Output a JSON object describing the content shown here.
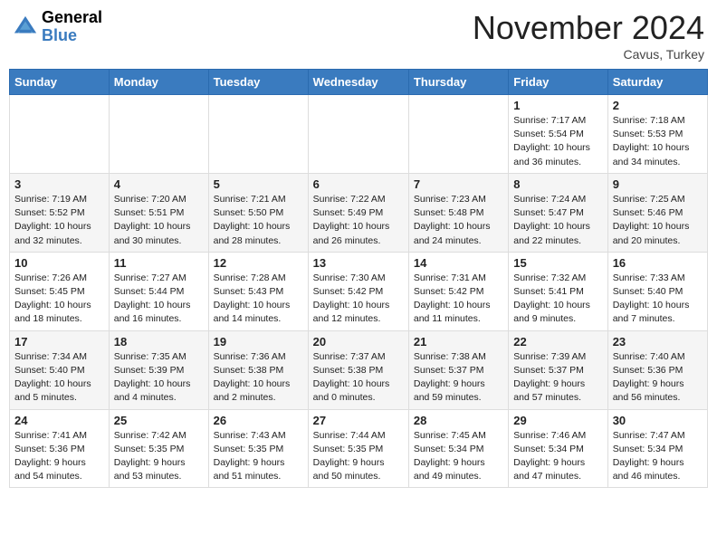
{
  "header": {
    "logo_line1": "General",
    "logo_line2": "Blue",
    "month_title": "November 2024",
    "location": "Cavus, Turkey"
  },
  "days_of_week": [
    "Sunday",
    "Monday",
    "Tuesday",
    "Wednesday",
    "Thursday",
    "Friday",
    "Saturday"
  ],
  "weeks": [
    {
      "days": [
        {
          "num": "",
          "info": ""
        },
        {
          "num": "",
          "info": ""
        },
        {
          "num": "",
          "info": ""
        },
        {
          "num": "",
          "info": ""
        },
        {
          "num": "",
          "info": ""
        },
        {
          "num": "1",
          "info": "Sunrise: 7:17 AM\nSunset: 5:54 PM\nDaylight: 10 hours\nand 36 minutes."
        },
        {
          "num": "2",
          "info": "Sunrise: 7:18 AM\nSunset: 5:53 PM\nDaylight: 10 hours\nand 34 minutes."
        }
      ]
    },
    {
      "days": [
        {
          "num": "3",
          "info": "Sunrise: 7:19 AM\nSunset: 5:52 PM\nDaylight: 10 hours\nand 32 minutes."
        },
        {
          "num": "4",
          "info": "Sunrise: 7:20 AM\nSunset: 5:51 PM\nDaylight: 10 hours\nand 30 minutes."
        },
        {
          "num": "5",
          "info": "Sunrise: 7:21 AM\nSunset: 5:50 PM\nDaylight: 10 hours\nand 28 minutes."
        },
        {
          "num": "6",
          "info": "Sunrise: 7:22 AM\nSunset: 5:49 PM\nDaylight: 10 hours\nand 26 minutes."
        },
        {
          "num": "7",
          "info": "Sunrise: 7:23 AM\nSunset: 5:48 PM\nDaylight: 10 hours\nand 24 minutes."
        },
        {
          "num": "8",
          "info": "Sunrise: 7:24 AM\nSunset: 5:47 PM\nDaylight: 10 hours\nand 22 minutes."
        },
        {
          "num": "9",
          "info": "Sunrise: 7:25 AM\nSunset: 5:46 PM\nDaylight: 10 hours\nand 20 minutes."
        }
      ]
    },
    {
      "days": [
        {
          "num": "10",
          "info": "Sunrise: 7:26 AM\nSunset: 5:45 PM\nDaylight: 10 hours\nand 18 minutes."
        },
        {
          "num": "11",
          "info": "Sunrise: 7:27 AM\nSunset: 5:44 PM\nDaylight: 10 hours\nand 16 minutes."
        },
        {
          "num": "12",
          "info": "Sunrise: 7:28 AM\nSunset: 5:43 PM\nDaylight: 10 hours\nand 14 minutes."
        },
        {
          "num": "13",
          "info": "Sunrise: 7:30 AM\nSunset: 5:42 PM\nDaylight: 10 hours\nand 12 minutes."
        },
        {
          "num": "14",
          "info": "Sunrise: 7:31 AM\nSunset: 5:42 PM\nDaylight: 10 hours\nand 11 minutes."
        },
        {
          "num": "15",
          "info": "Sunrise: 7:32 AM\nSunset: 5:41 PM\nDaylight: 10 hours\nand 9 minutes."
        },
        {
          "num": "16",
          "info": "Sunrise: 7:33 AM\nSunset: 5:40 PM\nDaylight: 10 hours\nand 7 minutes."
        }
      ]
    },
    {
      "days": [
        {
          "num": "17",
          "info": "Sunrise: 7:34 AM\nSunset: 5:40 PM\nDaylight: 10 hours\nand 5 minutes."
        },
        {
          "num": "18",
          "info": "Sunrise: 7:35 AM\nSunset: 5:39 PM\nDaylight: 10 hours\nand 4 minutes."
        },
        {
          "num": "19",
          "info": "Sunrise: 7:36 AM\nSunset: 5:38 PM\nDaylight: 10 hours\nand 2 minutes."
        },
        {
          "num": "20",
          "info": "Sunrise: 7:37 AM\nSunset: 5:38 PM\nDaylight: 10 hours\nand 0 minutes."
        },
        {
          "num": "21",
          "info": "Sunrise: 7:38 AM\nSunset: 5:37 PM\nDaylight: 9 hours\nand 59 minutes."
        },
        {
          "num": "22",
          "info": "Sunrise: 7:39 AM\nSunset: 5:37 PM\nDaylight: 9 hours\nand 57 minutes."
        },
        {
          "num": "23",
          "info": "Sunrise: 7:40 AM\nSunset: 5:36 PM\nDaylight: 9 hours\nand 56 minutes."
        }
      ]
    },
    {
      "days": [
        {
          "num": "24",
          "info": "Sunrise: 7:41 AM\nSunset: 5:36 PM\nDaylight: 9 hours\nand 54 minutes."
        },
        {
          "num": "25",
          "info": "Sunrise: 7:42 AM\nSunset: 5:35 PM\nDaylight: 9 hours\nand 53 minutes."
        },
        {
          "num": "26",
          "info": "Sunrise: 7:43 AM\nSunset: 5:35 PM\nDaylight: 9 hours\nand 51 minutes."
        },
        {
          "num": "27",
          "info": "Sunrise: 7:44 AM\nSunset: 5:35 PM\nDaylight: 9 hours\nand 50 minutes."
        },
        {
          "num": "28",
          "info": "Sunrise: 7:45 AM\nSunset: 5:34 PM\nDaylight: 9 hours\nand 49 minutes."
        },
        {
          "num": "29",
          "info": "Sunrise: 7:46 AM\nSunset: 5:34 PM\nDaylight: 9 hours\nand 47 minutes."
        },
        {
          "num": "30",
          "info": "Sunrise: 7:47 AM\nSunset: 5:34 PM\nDaylight: 9 hours\nand 46 minutes."
        }
      ]
    }
  ]
}
